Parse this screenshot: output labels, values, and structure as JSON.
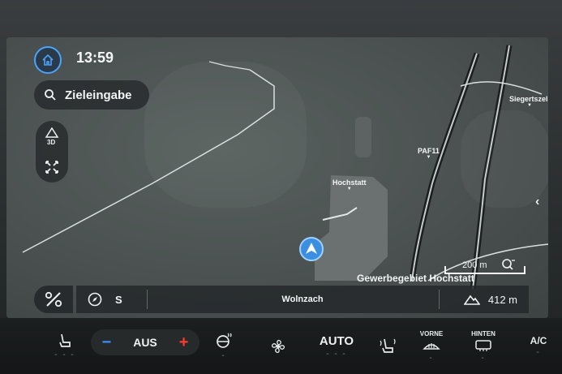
{
  "header": {
    "time": "13:59"
  },
  "search": {
    "label": "Zieleingabe"
  },
  "map": {
    "labels": {
      "siegertszell": "Siegertszell",
      "paf11": "PAF11",
      "hochstatt": "Hochstatt"
    },
    "scale": "200 m",
    "location": "Gewerbegebiet Hochstatt"
  },
  "info_bar": {
    "heading": "S",
    "road": "Wolnzach",
    "elevation": "412 m"
  },
  "climate": {
    "fan": "AUS",
    "fan_minus": "−",
    "fan_plus": "+",
    "auto": "AUTO",
    "front": "VORNE",
    "rear": "HINTEN",
    "ac": "A/C",
    "dashes": "- - -"
  },
  "icons": [
    "home-icon",
    "search-icon",
    "3d-view-icon",
    "fit-route-icon",
    "route-options-icon",
    "compass-icon",
    "elevation-icon",
    "zoom-search-icon",
    "seat-icon",
    "steering-heat-icon",
    "fan-icon",
    "seat-climate-icon",
    "front-defrost-icon",
    "rear-defrost-icon",
    "nav-arrow-icon"
  ],
  "colors": {
    "accent": "#4aa3ff",
    "minus": "#3a8fff",
    "plus": "#ff3b30"
  }
}
